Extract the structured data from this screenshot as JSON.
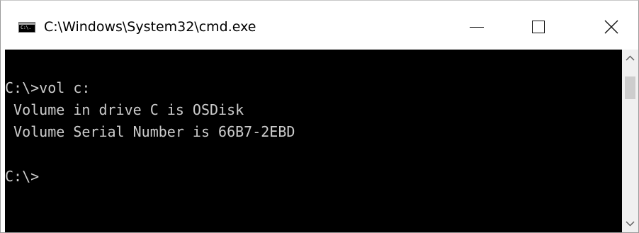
{
  "window": {
    "title": "C:\\Windows\\System32\\cmd.exe",
    "icon": "cmd-console-icon",
    "icon_label": "C:\\."
  },
  "caption_buttons": {
    "minimize_icon": "minimize-icon",
    "maximize_icon": "maximize-icon",
    "close_icon": "close-icon"
  },
  "console": {
    "lines": [
      "C:\\>vol c:",
      " Volume in drive C is OSDisk",
      " Volume Serial Number is 66B7-2EBD",
      "",
      "C:\\>"
    ],
    "foreground_color": "#cccccc",
    "background_color": "#000000"
  },
  "scrollbar": {
    "up_icon": "chevron-up-icon",
    "down_icon": "chevron-down-icon"
  }
}
